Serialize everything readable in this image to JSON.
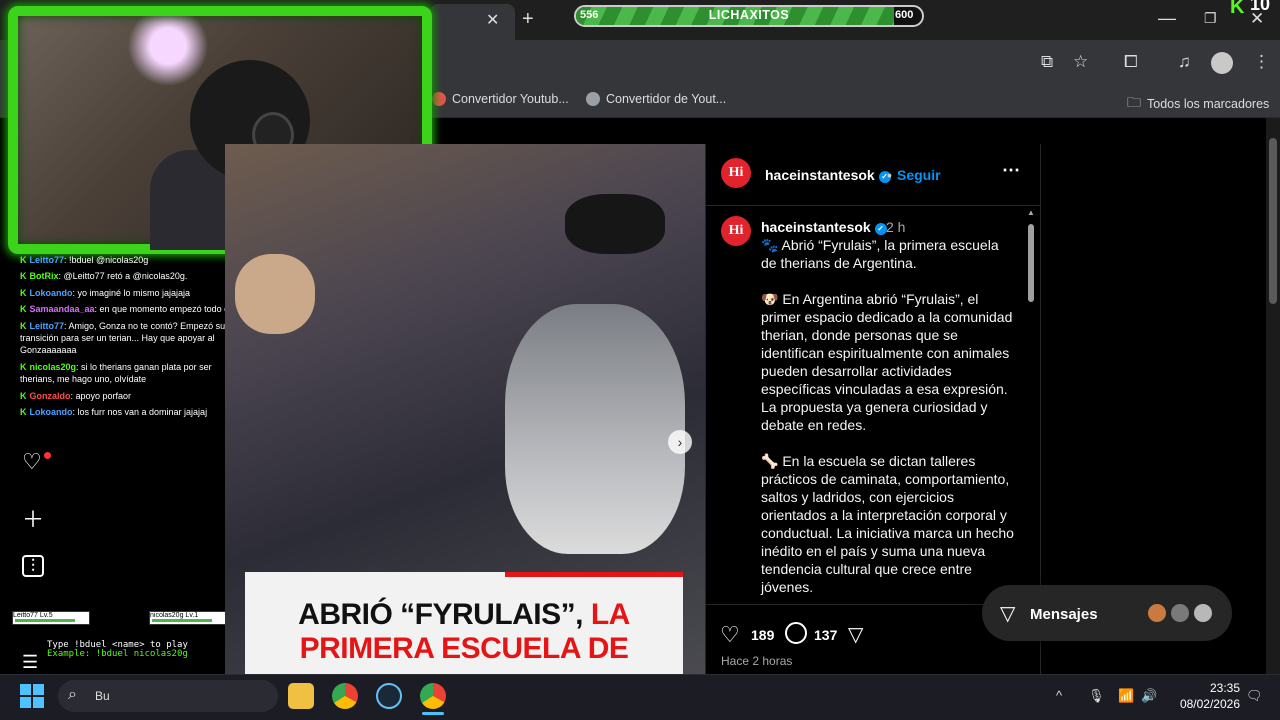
{
  "browser": {
    "bookmarks": [
      {
        "label": "Convertidor Youtub...",
        "color": "#e0564a"
      },
      {
        "label": "Convertidor de Yout...",
        "color": "#9aa0a6"
      }
    ],
    "bookmarks_all": "Todos los marcadores"
  },
  "overlay": {
    "xp_left": "556",
    "xp_label": "LICHAXITOS",
    "xp_right": "600",
    "xp_fraction": 0.92,
    "corner_k": "K",
    "corner_number": "10"
  },
  "chat": [
    {
      "user": "Leitto77",
      "user_color": "#4aa3ff",
      "text": ": !bduel @nicolas20g"
    },
    {
      "user": "BotRix",
      "user_color": "#53fc18",
      "text": ": @Leitto77 retó a @nicolas20g."
    },
    {
      "user": "Lokoando",
      "user_color": "#4aa3ff",
      "text": ": yo imaginé lo mismo jajajaja"
    },
    {
      "user": "Samaandaa_aa",
      "user_color": "#d66cff",
      "text": ": en que momento empezó todo eso"
    },
    {
      "user": "Leitto77",
      "user_color": "#4aa3ff",
      "text": ": Amigo, Gonza no te contó? Empezó su transición para ser un terian... Hay que apoyar al Gonzaaaaaaa"
    },
    {
      "user": "nicolas20g",
      "user_color": "#53fc18",
      "text": ": si lo therians ganan plata por ser therians, me hago uno, olvídate"
    },
    {
      "user": "Gonzaldo",
      "user_color": "#ff4d4d",
      "text": ": apoyo porfaor"
    },
    {
      "user": "Lokoando",
      "user_color": "#4aa3ff",
      "text": ": los furr nos van a dominar jajajaj"
    }
  ],
  "game": {
    "player1": "Leitto77",
    "player1_lv": "Lv.5",
    "player2": "nicolas20g",
    "player2_lv": "Lv.1",
    "line1": "Type !bduel <name> to play",
    "line2": "Example: !bduel nicolas20g"
  },
  "post": {
    "avatar_text": "Hi",
    "username": "haceinstantesok",
    "follow": "Seguir",
    "time": "2 h",
    "caption": "🐾 Abrió “Fyrulais”, la primera escuela de therians de Argentina.\n\n🐶 En Argentina abrió “Fyrulais”, el primer espacio dedicado a la comunidad therian, donde personas que se identifican espiritualmente con animales pueden desarrollar actividades específicas vinculadas a esa expresión. La propuesta ya genera curiosidad y debate en redes.\n\n🦴 En la escuela se dictan talleres prácticos de caminata, comportamiento, saltos y ladridos, con ejercicios orientados a la interpretación corporal y conductual. La iniciativa marca un hecho inédito en el país y suma una nueva tendencia cultural que crece entre jóvenes.",
    "banner_black_1": "ABRIÓ “FYRULAIS”,",
    "banner_red_1": " LA",
    "banner_red_2": "PRIMERA ESCUELA DE",
    "likes": "189",
    "comments": "137",
    "age": "Hace 2 horas"
  },
  "messages": {
    "label": "Mensajes"
  },
  "taskbar": {
    "search_text": "Bu",
    "time": "23:35",
    "date": "08/02/2026"
  }
}
